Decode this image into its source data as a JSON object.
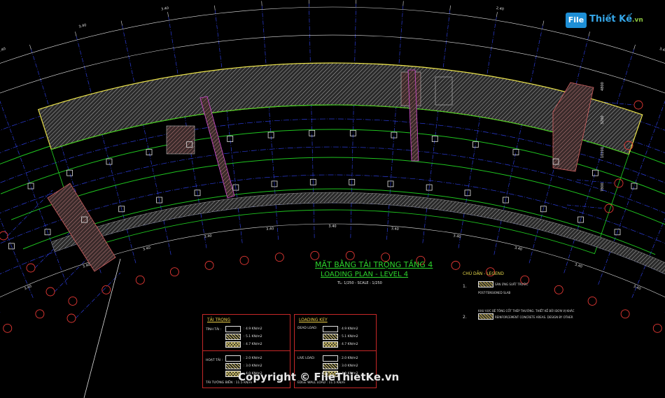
{
  "logo": {
    "box": "File",
    "name": "Thiết Kế",
    "suffix": ".vn"
  },
  "title": {
    "vn": "MẶT BẰNG TẢI TRỌNG TẦNG 4",
    "en": "LOADING PLAN - LEVEL 4",
    "scale": "TL: 1/250 - SCALE : 1/250"
  },
  "legend": {
    "heading": "CHÚ DẪN - LEGEND",
    "items": [
      {
        "no": "1.",
        "vn": "SÀN ỨNG SUẤT TRƯỚC",
        "en": "POST-TENSIONED SLAB"
      },
      {
        "no": "2.",
        "vn": "KHU VỰC BÊ TÔNG CỐT THÉP THƯỜNG. THIẾT KẾ BỞI ĐƠN VỊ KHÁC",
        "en": "REINFORCEMENT CONCRETE AREAS. DESIGN BY OTHER"
      }
    ]
  },
  "load_table": {
    "heading": "TẢI TRỌNG",
    "group1_label": "TĨNH TẢI :",
    "group1": [
      ": 4.9 KN/m2",
      ": 5.1 KN/m2",
      ": 4.7 KN/m2"
    ],
    "group2_label": "HOẠT TẢI :",
    "group2": [
      ": 2.0 KN/m2",
      ": 3.0 KN/m2",
      ": 4.0 KN/m2"
    ],
    "footer": "TẢI TƯỜNG BIÊN : 11.5 KN/m"
  },
  "key_table": {
    "heading": "LOADING KEY",
    "group1_label": "DEAD LOAD:",
    "group1": [
      ": 4.9 KN/m2",
      ": 5.1 KN/m2",
      ": 4.7 KN/m2"
    ],
    "group2_label": "LIVE LOAD:",
    "group2": [
      ": 2.0 KN/m2",
      ": 3.0 KN/m2",
      ": 4.0 KN/m2"
    ],
    "footer": "EDGE WALL LOAD : 11.5 KN/m"
  },
  "dims": {
    "outer": [
      "10.00",
      "2.40",
      "3.40",
      "3.40",
      "3.40",
      "3.40",
      "3.40",
      "2.40",
      "3.40",
      "3.40",
      "3.40"
    ],
    "inner": [
      "3.40",
      "3.40",
      "3.40",
      "3.40",
      "3.40",
      "3.40",
      "3.40",
      "3.40",
      "3.40",
      "3.40",
      "3.40"
    ],
    "right": [
      "4800",
      "3200",
      "10200",
      "7800"
    ]
  },
  "copyright": "Copyright © FileThietKe.vn"
}
